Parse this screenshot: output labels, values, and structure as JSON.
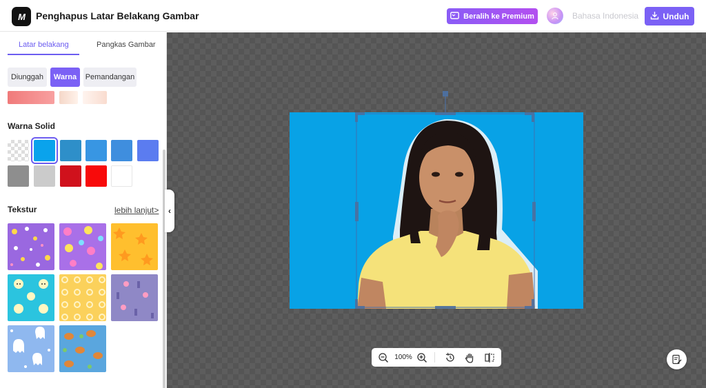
{
  "header": {
    "logo_text": "M",
    "title": "Penghapus Latar Belakang Gambar",
    "premium_label": "Beralih ke Premium",
    "language": "Bahasa Indonesia",
    "download_label": "Unduh"
  },
  "sidebar": {
    "tabs": [
      {
        "label": "Latar belakang",
        "active": true
      },
      {
        "label": "Pangkas Gambar",
        "active": false
      }
    ],
    "segments": [
      {
        "label": "Diunggah",
        "active": false
      },
      {
        "label": "Warna",
        "active": true
      },
      {
        "label": "Pemandangan",
        "active": false
      }
    ],
    "solid_label": "Warna Solid",
    "solid_colors": [
      {
        "name": "transparent",
        "color": "transparent",
        "selected": false
      },
      {
        "name": "sky-blue",
        "color": "#0aa3ec",
        "selected": true
      },
      {
        "name": "steel-blue",
        "color": "#2e8fc9",
        "selected": false
      },
      {
        "name": "light-blue",
        "color": "#3896e3",
        "selected": false
      },
      {
        "name": "medium-blue",
        "color": "#3f8ede",
        "selected": false
      },
      {
        "name": "periwinkle",
        "color": "#5b7cf0",
        "selected": false
      },
      {
        "name": "gray",
        "color": "#8e8e8e",
        "selected": false
      },
      {
        "name": "light-gray",
        "color": "#cbcbcb",
        "selected": false
      },
      {
        "name": "dark-red",
        "color": "#d0111c",
        "selected": false
      },
      {
        "name": "red",
        "color": "#f80a0a",
        "selected": false
      },
      {
        "name": "white",
        "color": "#ffffff",
        "selected": false
      }
    ],
    "texture_label": "Tekstur",
    "more_label": "lebih lanjut>",
    "textures": [
      {
        "name": "purple-flowers",
        "color": "#9a68e0"
      },
      {
        "name": "pink-flowers",
        "color": "#a970e8"
      },
      {
        "name": "yellow-stars",
        "color": "#ffbf2e"
      },
      {
        "name": "cyan-bears",
        "color": "#2bc4df"
      },
      {
        "name": "yellow-dots",
        "color": "#fbd15b"
      },
      {
        "name": "lavender-pattern",
        "color": "#8f88c6"
      },
      {
        "name": "blue-ghosts",
        "color": "#8fb8ef"
      },
      {
        "name": "blue-animals",
        "color": "#5aa6de"
      }
    ]
  },
  "canvas": {
    "zoom": "100%",
    "background_color": "#08a2e6"
  },
  "colors": {
    "accent": "#7b61f5"
  }
}
